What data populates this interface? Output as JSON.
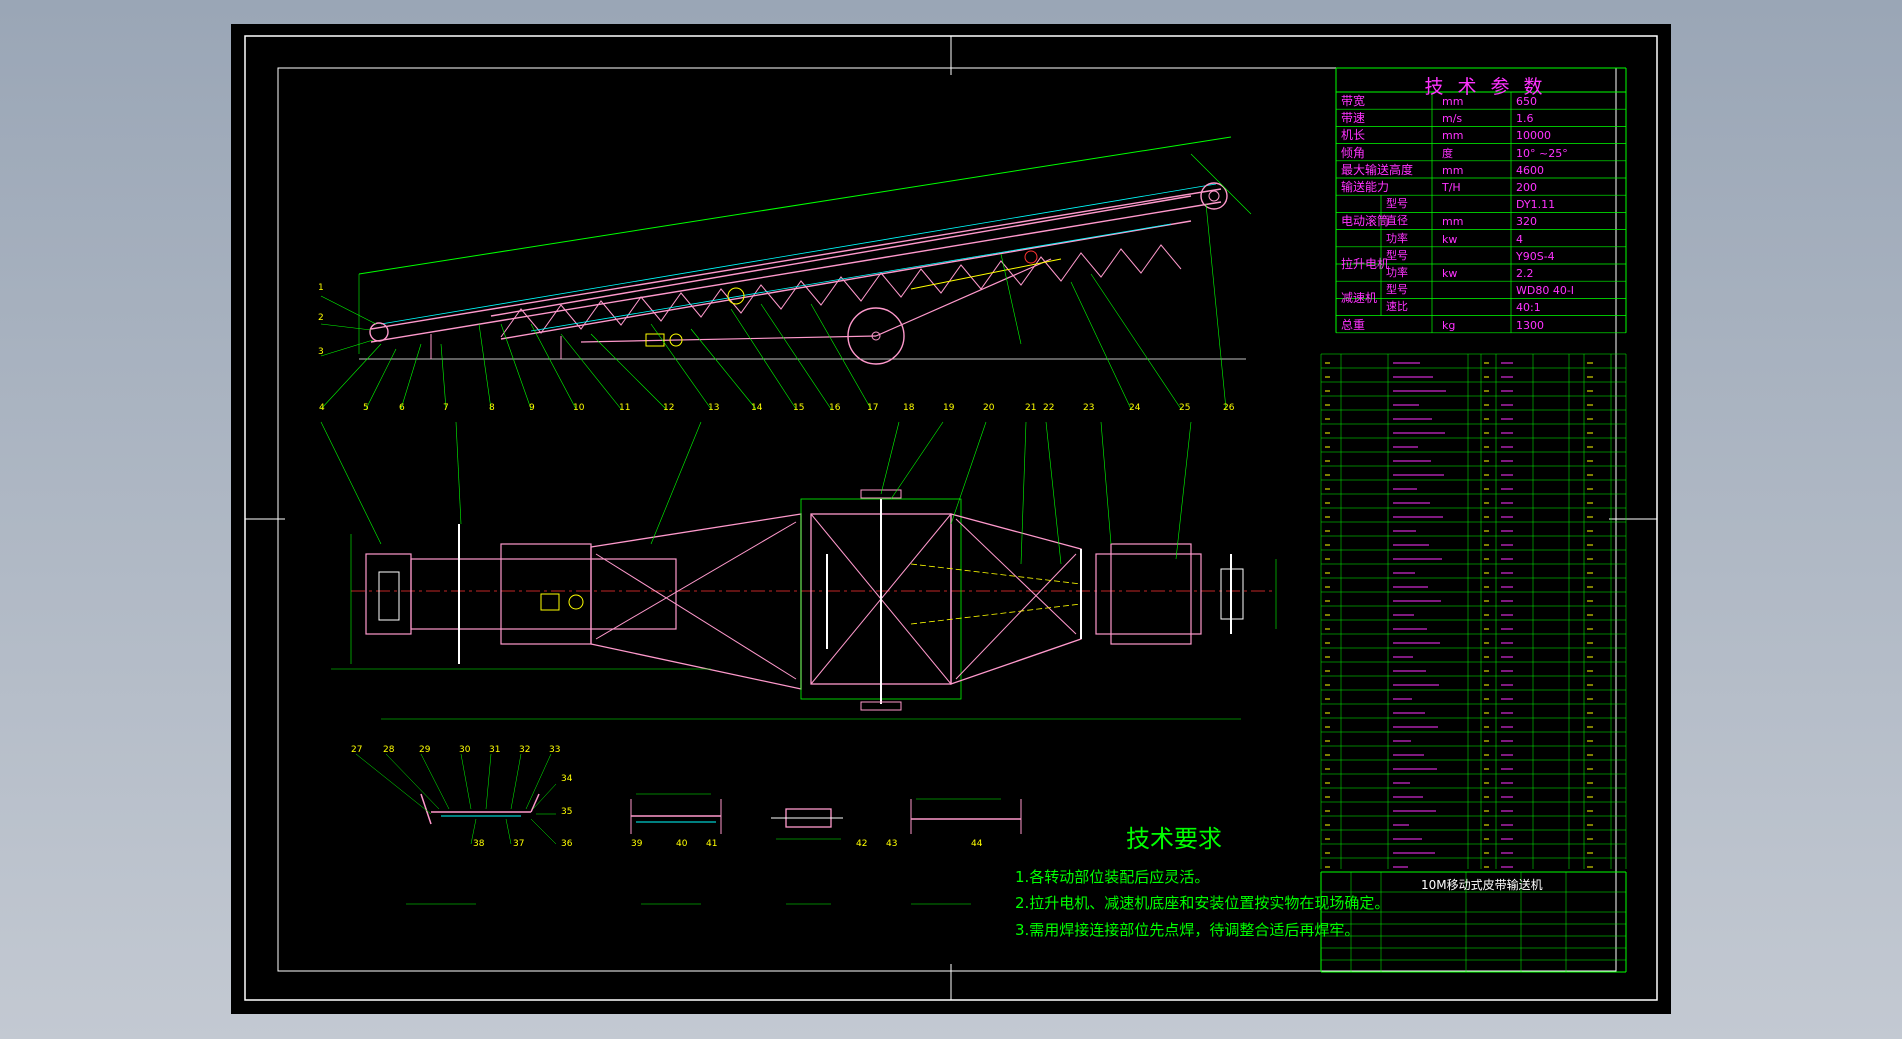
{
  "param_table": {
    "title": "技 术 参 数",
    "rows": [
      {
        "name": "带宽",
        "unit": "mm",
        "value": "650"
      },
      {
        "name": "带速",
        "unit": "m/s",
        "value": "1.6"
      },
      {
        "name": "机长",
        "unit": "mm",
        "value": "10000"
      },
      {
        "name": "倾角",
        "unit": "度",
        "value": "10° ~25°"
      },
      {
        "name": "最大输送高度",
        "unit": "mm",
        "value": "4600"
      },
      {
        "name": "输送能力",
        "unit": "T/H",
        "value": "200"
      }
    ],
    "groups": [
      {
        "name": "电动滚筒",
        "rows": [
          {
            "sub": "型号",
            "unit": "",
            "value": "DY1.11"
          },
          {
            "sub": "直径",
            "unit": "mm",
            "value": "320"
          },
          {
            "sub": "功率",
            "unit": "kw",
            "value": "4"
          }
        ]
      },
      {
        "name": "拉升电机",
        "rows": [
          {
            "sub": "型号",
            "unit": "",
            "value": "Y90S-4"
          },
          {
            "sub": "功率",
            "unit": "kw",
            "value": "2.2"
          }
        ]
      },
      {
        "name": "减速机",
        "rows": [
          {
            "sub": "型号",
            "unit": "",
            "value": "WD80 40-I"
          },
          {
            "sub": "速比",
            "unit": "",
            "value": "40:1"
          }
        ]
      }
    ],
    "total": {
      "name": "总重",
      "unit": "kg",
      "value": "1300"
    }
  },
  "requirements": {
    "title": "技术要求",
    "items": [
      "1.各转动部位装配后应灵活。",
      "2.拉升电机、减速机底座和安装位置按实物在现场确定。",
      "3.需用焊接连接部位先点焊，待调整合适后再焊牢。"
    ]
  },
  "title_block": {
    "drawing_name": "10M移动式皮带输送机"
  },
  "callouts_side": [
    "1",
    "2",
    "3",
    "4",
    "5",
    "6",
    "7",
    "8",
    "9",
    "10",
    "11",
    "12",
    "13",
    "14",
    "15",
    "16",
    "17",
    "18",
    "19",
    "20",
    "21",
    "22",
    "23",
    "24",
    "25",
    "26"
  ],
  "callouts_detail": [
    "27",
    "28",
    "29",
    "30",
    "31",
    "32",
    "33",
    "34",
    "35",
    "36",
    "37",
    "38",
    "39",
    "40",
    "41",
    "42",
    "43",
    "44"
  ],
  "colors": {
    "background": "#000000",
    "border": "#ffffff",
    "frame_green": "#00ff00",
    "table_magenta": "#ff33ff",
    "table_cyan": "#00ffff",
    "table_yellow": "#ffff00",
    "structure_pink": "#ff99cc",
    "center_red": "#ff3333"
  }
}
